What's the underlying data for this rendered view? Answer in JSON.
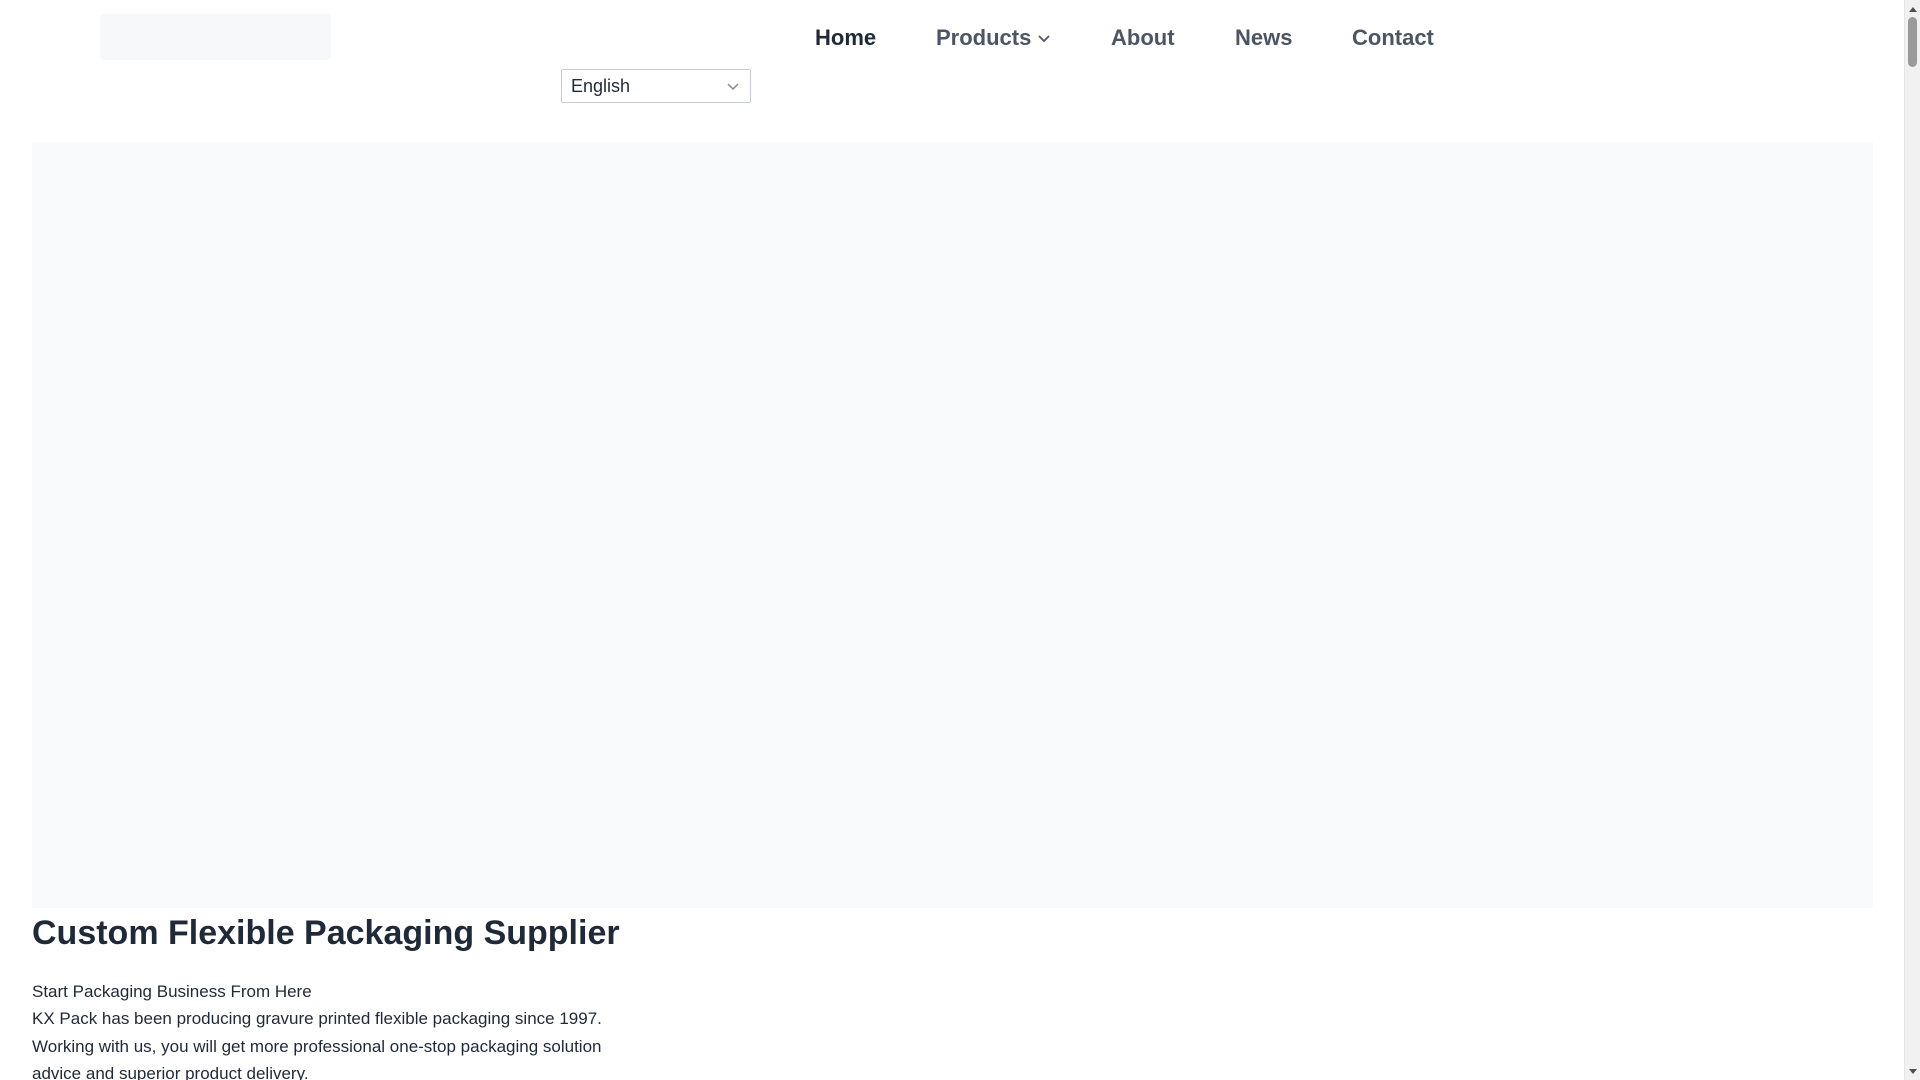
{
  "nav": {
    "items": [
      {
        "label": "Home"
      },
      {
        "label": "Products"
      },
      {
        "label": "About"
      },
      {
        "label": "News"
      },
      {
        "label": "Contact"
      }
    ],
    "active": "Home"
  },
  "language_select": {
    "value": "English"
  },
  "main": {
    "title": "Custom Flexible Packaging Supplier",
    "tagline": "Start Packaging Business From Here",
    "description": "KX Pack has been producing gravure printed flexible packaging since 1997. Working with us, you will get more professional one-stop packaging solution advice and superior product delivery."
  },
  "icons": {
    "products_dropdown": "chevron-down-icon",
    "language_dropdown": "chevron-down-icon",
    "scroll_up": "triangle-up-icon",
    "scroll_down": "triangle-down-icon"
  },
  "colors": {
    "nav_text": "#4b5563",
    "nav_active": "#1f2937",
    "hero_background": "#f8fafc"
  }
}
